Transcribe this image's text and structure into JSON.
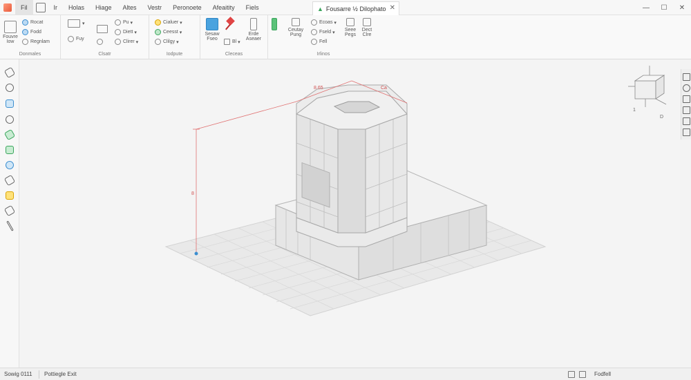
{
  "titlebar": {
    "menu": [
      "Fil",
      "Ir",
      "Holas",
      "Hiage",
      "Altes",
      "Vestr",
      "Peronoete",
      "Afeaitity",
      "Fiels"
    ],
    "document_tab": "Fousarre ½ Dilophato",
    "controls": [
      "—",
      "☐",
      "✕"
    ]
  },
  "ribbon": {
    "groups": [
      {
        "label": "Donmales",
        "buttons": [
          "Rocat",
          "Fodd",
          "Regnlam"
        ],
        "big_button": "Fouvre Iow"
      },
      {
        "label": "Clsatr",
        "buttons": [
          "Fuy",
          "Pu",
          "Diett",
          "Clirer"
        ]
      },
      {
        "label": "Iodpute",
        "buttons": [
          "Cialuer",
          "Ceesst",
          "Clilgy"
        ]
      },
      {
        "label": "Cleceas",
        "buttons": [
          "Sesaw Fseo",
          "Erde Aseaer",
          "Bl"
        ]
      },
      {
        "label": "Irlinos",
        "buttons": [
          "Ceutay Pung",
          "Ecoas",
          "Fseld",
          "Fell",
          "Seee Pegs",
          "Dect Clre"
        ]
      }
    ]
  },
  "viewport": {
    "dimension_top": "8.65",
    "dimension_top_right": "Ca",
    "dimension_side": "8"
  },
  "viewcube": {
    "labels": [
      "1",
      "D"
    ]
  },
  "statusbar": {
    "left": "Sowig 0111",
    "mid": "Pottiegle Exit",
    "right": "Fodfell"
  }
}
